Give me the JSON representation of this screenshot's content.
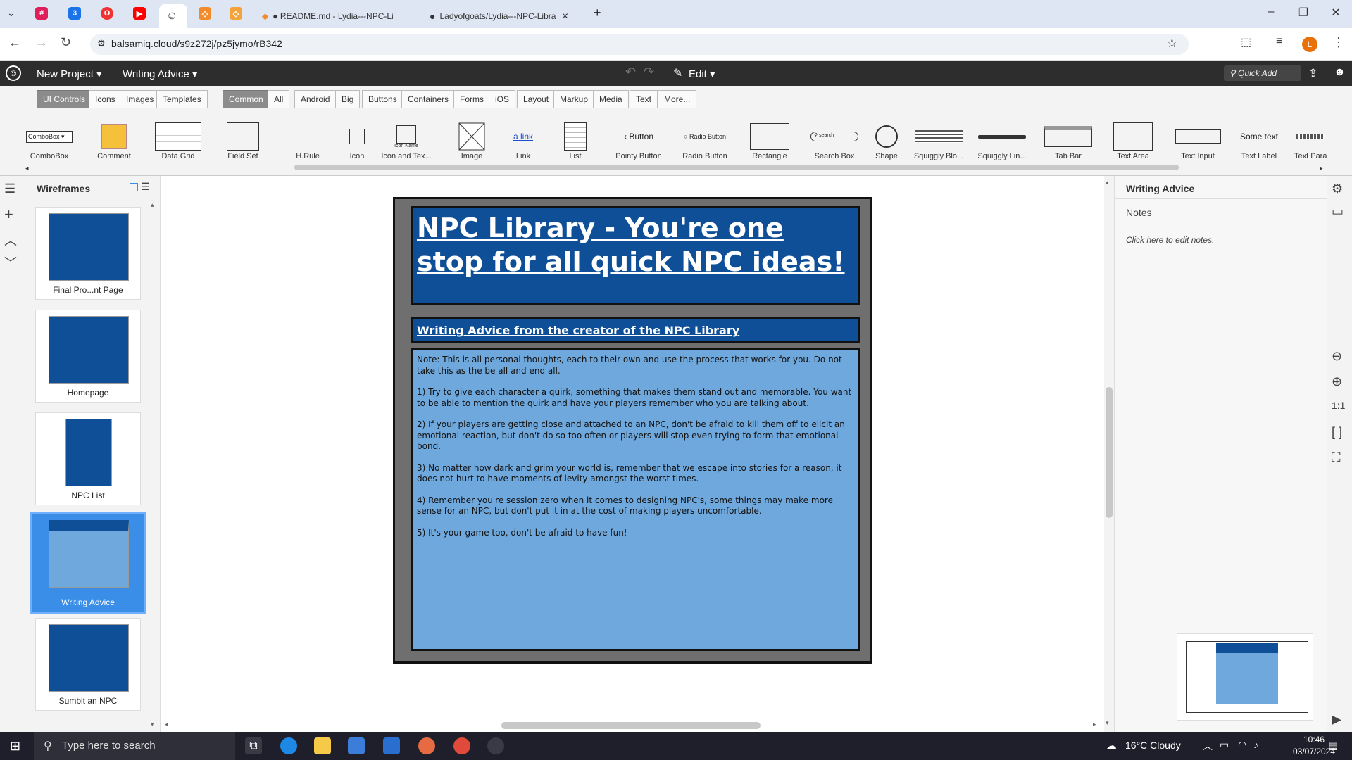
{
  "browser": {
    "tabs": [
      {
        "label": "● README.md - Lydia---NPC-Li",
        "active": false
      },
      {
        "label": "Ladyofgoats/Lydia---NPC-Libra",
        "active": false
      }
    ],
    "url": "balsamiq.cloud/s9z272j/pz5jymo/rB342",
    "profile_initial": "L"
  },
  "app": {
    "project_menu": "New Project ▾",
    "page_menu": "Writing Advice ▾",
    "edit_menu": "Edit ▾",
    "quick_add": "Quick Add"
  },
  "library": {
    "tabs": [
      "UI Controls",
      "Icons",
      "Images",
      "Templates"
    ],
    "categories": [
      "Common",
      "All",
      "Android",
      "Big",
      "Buttons",
      "Containers",
      "Forms",
      "iOS",
      "Layout",
      "Markup",
      "Media",
      "Text",
      "More..."
    ],
    "controls": [
      "ComboBox",
      "Comment",
      "Data Grid",
      "Field Set",
      "H.Rule",
      "Icon",
      "Icon and Tex...",
      "Image",
      "Link",
      "List",
      "Pointy Button",
      "Radio Button",
      "Rectangle",
      "Search Box",
      "Shape",
      "Squiggly Blo...",
      "Squiggly Lin...",
      "Tab Bar",
      "Text Area",
      "Text Input",
      "Text Label",
      "Text Para"
    ],
    "sample_texts": {
      "combobox": "ComboBox",
      "icon_name": "Icon Name",
      "link": "a link",
      "button": "Button",
      "radio": "Radio Button",
      "search": "search",
      "text_label": "Some text"
    }
  },
  "wireframes": {
    "title": "Wireframes",
    "items": [
      {
        "label": "Final Pro...nt Page",
        "selected": false
      },
      {
        "label": "Homepage",
        "selected": false
      },
      {
        "label": "NPC List",
        "selected": false
      },
      {
        "label": "Writing Advice",
        "selected": true
      },
      {
        "label": "Sumbit an NPC",
        "selected": false
      }
    ]
  },
  "mockup": {
    "banner": "NPC Library - You're one stop for all quick NPC ideas!",
    "subtitle": "Writing Advice from the creator of the NPC Library",
    "paragraphs": [
      "Note: This is all personal thoughts, each to their own and use the process that works for you. Do not take this as the be all and end all.",
      "1) Try to give each character a quirk, something that makes them stand out and memorable. You want to be able to mention the quirk and have your players remember who you are talking about.",
      "2) If your players are getting close and attached to an NPC, don't be afraid to kill them off to elicit an emotional reaction, but don't do so too often or players will stop even trying to form that emotional bond.",
      "3) No matter how dark and grim your world is, remember that we escape into stories for a reason, it does not hurt to have moments of levity amongst the worst times.",
      "4) Remember you're session zero when it comes to designing NPC's, some things may make more sense for an NPC, but don't put it in at the cost of making players uncomfortable.",
      "5) It's your game too, don't be afraid to have fun!"
    ]
  },
  "right_panel": {
    "title": "Writing Advice",
    "notes_label": "Notes",
    "notes_placeholder": "Click here to edit notes.",
    "zoom_label": "1:1"
  },
  "taskbar": {
    "search_placeholder": "Type here to search",
    "weather": "16°C  Cloudy",
    "time": "10:46",
    "date": "03/07/2024"
  },
  "colors": {
    "mock_blue": "#0e4f98",
    "note_blue": "#6fa8dc",
    "selection": "#3b8ee8"
  }
}
